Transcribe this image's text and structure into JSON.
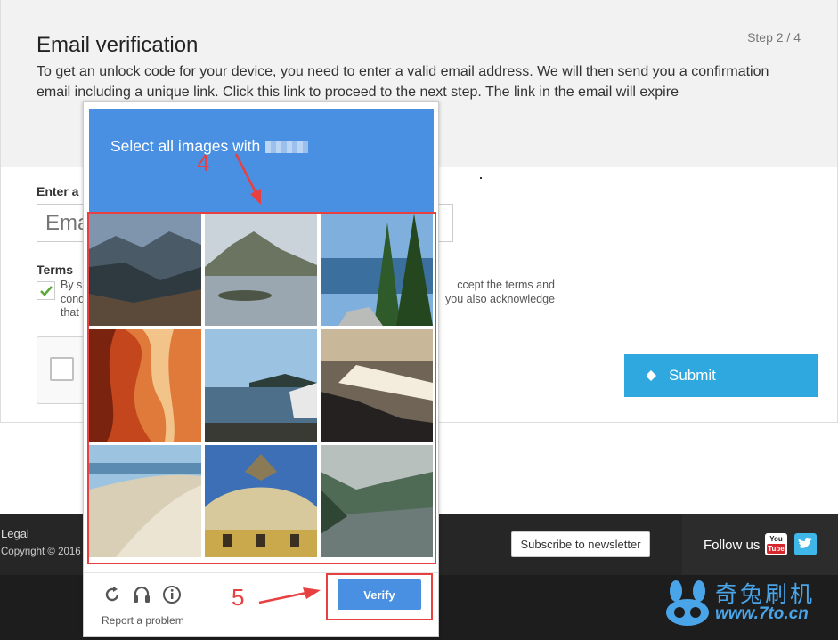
{
  "page": {
    "title": "Email verification",
    "step": "Step 2 / 4",
    "intro": "To get an unlock code for your device, you need to enter a valid email address. We will then send you a confirmation email including a unique link. Click this link to proceed to the next step. The link in the email will expire",
    "email_label": "Enter a",
    "email_placeholder": "Ema",
    "terms_label": "Terms",
    "terms_text_a": "By s",
    "terms_text_a2": "ccept the terms and",
    "terms_text_b": "cond",
    "terms_text_b2": "you also acknowledge",
    "terms_text_c": "that",
    "submit_label": "Submit"
  },
  "footer": {
    "legal": "Legal",
    "copyright": "Copyright © 2016",
    "subscribe_label": "Subscribe to newsletter",
    "follow_label": "Follow us",
    "youtube_top": "You",
    "youtube_bottom": "Tube"
  },
  "watermark": {
    "brand_cn": "奇兔刷机",
    "url": "www.7to.cn"
  },
  "captcha": {
    "prompt": "Select all images with",
    "verify_label": "Verify",
    "report_label": "Report a problem",
    "controls": [
      "reload-icon",
      "audio-icon",
      "info-icon"
    ],
    "tiles": [
      "mountain-valley",
      "mountain-lake-islet",
      "pine-trees-coast",
      "red-canyon",
      "harbor-boat",
      "sunset-sea-rocks",
      "sand-dune",
      "ornate-building-eagle",
      "foggy-river-forest"
    ]
  },
  "annotations": {
    "step4": "4",
    "step5": "5"
  },
  "colors": {
    "captcha_blue": "#4a90e2",
    "annotation_red": "#e84040",
    "submit_blue": "#2fa8e0"
  }
}
